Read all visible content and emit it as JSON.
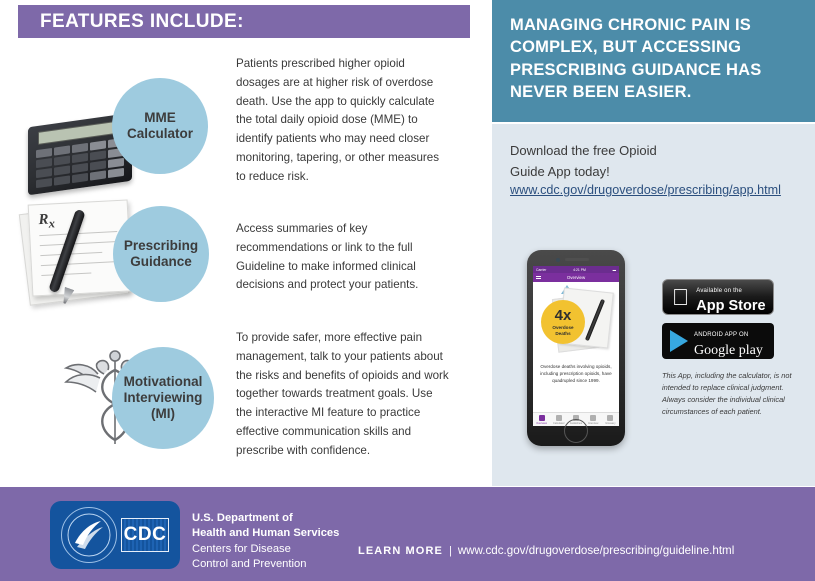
{
  "features_banner": {
    "title": "FEATURES INCLUDE:"
  },
  "features": [
    {
      "icon": "calculator-icon",
      "circle_label": "MME\nCalculator",
      "body": "Patients prescribed higher opioid dosages are at higher risk of overdose death. Use the app to quickly calculate the total daily opioid dose (MME) to identify patients who may need closer monitoring, tapering, or other measures to reduce risk."
    },
    {
      "icon": "prescription-pad-icon",
      "circle_label": "Prescribing\nGuidance",
      "body": "Access summaries of key recommendations or link to the full Guideline to make informed clinical decisions and protect your patients."
    },
    {
      "icon": "caduceus-icon",
      "circle_label": "Motivational\nInterviewing\n(MI)",
      "body": "To provide safer, more effective pain management, talk to your patients about the risks and benefits of opioids and work together towards treatment goals. Use the interactive MI feature to practice effective communication skills and prescribe with confidence."
    }
  ],
  "right_panel": {
    "headline": "MANAGING CHRONIC PAIN IS\nCOMPLEX, BUT ACCESSING\nPRESCRIBING GUIDANCE HAS\nNEVER BEEN EASIER.",
    "download_text": "Download the free Opioid\nGuide App today!",
    "download_url": "www.cdc.gov/drugoverdose/prescribing/app.html",
    "disclaimer": "This App, including the calculator, is not intended to replace clinical judgment. Always consider the individual clinical circumstances of each patient."
  },
  "phone": {
    "status_carrier": "Carrier",
    "status_time": "4:21 PM",
    "nav_title": "Overview",
    "badge_number": "4x",
    "badge_sub": "Overdose\nDeaths",
    "copy": "Overdose deaths involving opioids, including prescription opioids, have quadrupled since 1999.",
    "tabs": [
      {
        "label": "Overview",
        "icon": "chart-icon"
      },
      {
        "label": "Calculator",
        "icon": "keypad-icon"
      },
      {
        "label": "Guidelines",
        "icon": "book-icon"
      },
      {
        "label": "Interview",
        "icon": "chat-icon"
      },
      {
        "label": "Glossary",
        "icon": "list-icon"
      }
    ]
  },
  "store_badges": {
    "apple": {
      "small": "Available on the",
      "big": "App Store",
      "icon": "apple-icon"
    },
    "google": {
      "small": "ANDROID APP ON",
      "big": "Google play",
      "icon": "google-play-icon"
    }
  },
  "footer": {
    "logo_text": "CDC",
    "agency_line1": "U.S. Department of",
    "agency_line2": "Health and Human Services",
    "agency_line3": "Centers for Disease",
    "agency_line4": "Control and Prevention",
    "learn_more_label": "LEARN MORE",
    "learn_more_separator": "|",
    "learn_more_url": "www.cdc.gov/drugoverdose/prescribing/guideline.html"
  },
  "colors": {
    "purple": "#7e69a9",
    "teal": "#4c8ca9",
    "light_blue_panel": "#dfe7ee",
    "circle_blue": "#9ecbdf",
    "link_blue": "#2b4f7e",
    "cdc_blue": "#14549e"
  }
}
